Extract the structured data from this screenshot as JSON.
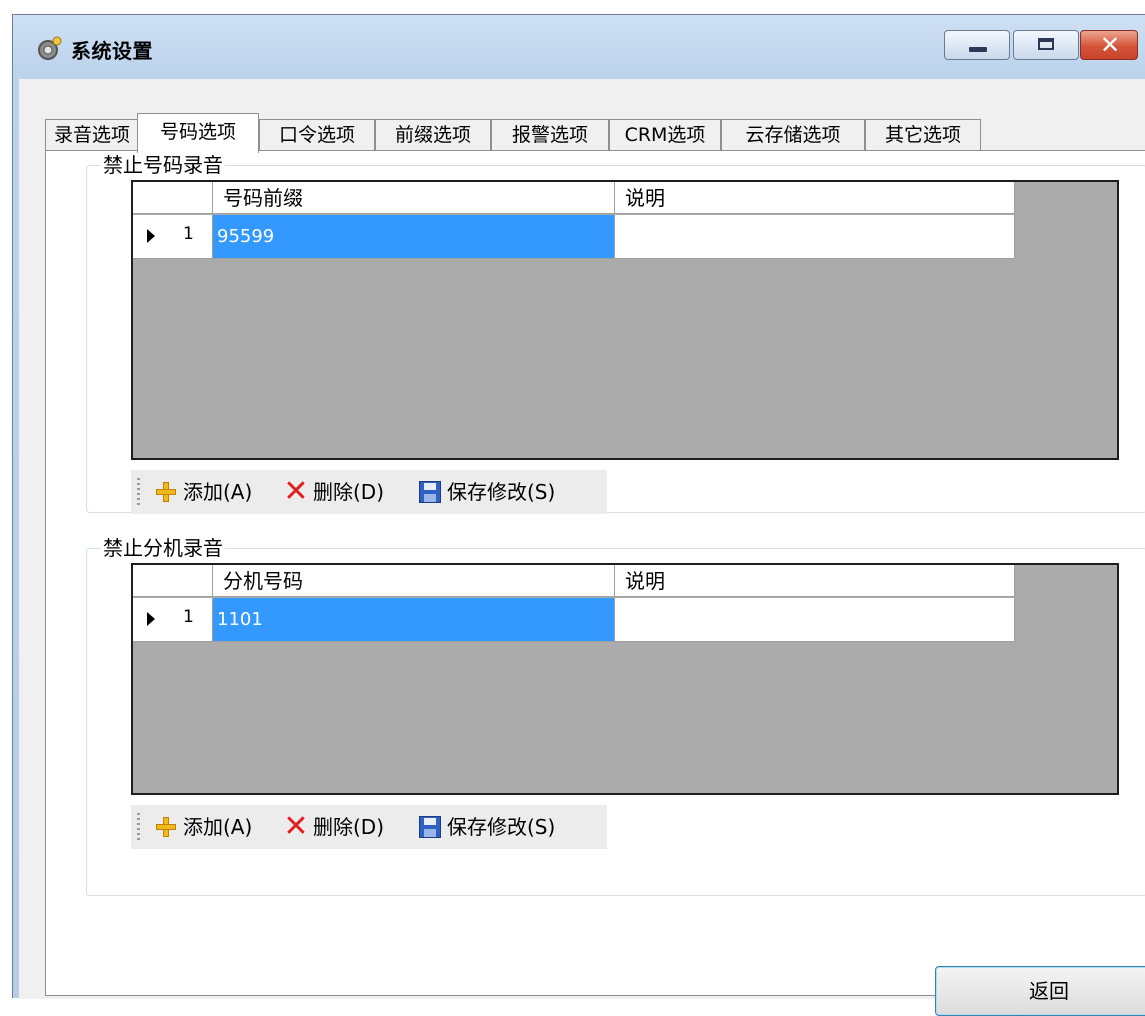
{
  "window": {
    "title": "系统设置"
  },
  "tabs": [
    "录音选项",
    "号码选项",
    "口令选项",
    "前缀选项",
    "报警选项",
    "CRM选项",
    "云存储选项",
    "其它选项"
  ],
  "active_tab": "号码选项",
  "number_block": {
    "title": "禁止号码录音",
    "columns": [
      "号码前缀",
      "说明"
    ],
    "rows": [
      {
        "index": "1",
        "prefix": "95599",
        "note": ""
      }
    ],
    "toolbar": {
      "add": "添加(A)",
      "delete": "删除(D)",
      "save": "保存修改(S)"
    }
  },
  "extension_block": {
    "title": "禁止分机录音",
    "columns": [
      "分机号码",
      "说明"
    ],
    "rows": [
      {
        "index": "1",
        "ext": "1101",
        "note": ""
      }
    ],
    "toolbar": {
      "add": "添加(A)",
      "delete": "删除(D)",
      "save": "保存修改(S)"
    }
  },
  "buttons": {
    "return": "返回"
  },
  "icons": {
    "app": "gear-icon",
    "add": "plus-icon",
    "delete": "x-icon",
    "save": "floppy-disk-icon",
    "minimize": "minimize-icon",
    "maximize": "maximize-icon",
    "close": "close-icon",
    "row": "row-pointer-icon"
  },
  "colors": {
    "selection": "#3399ff",
    "grid_background": "#ababab",
    "close_button": "#d4553a"
  }
}
